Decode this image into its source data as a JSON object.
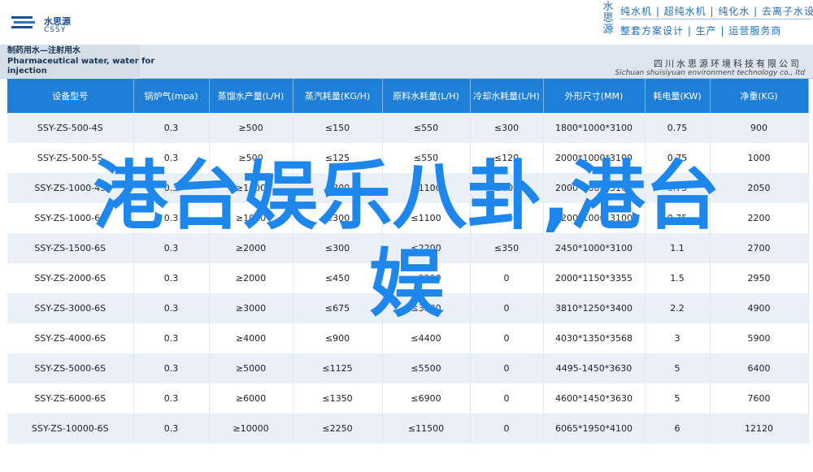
{
  "logo": {
    "cn": "水思源",
    "en": "CSSY"
  },
  "brand": {
    "vertical": "水思源",
    "line1": "纯水机 | 超纯水机 | 纯化水 | 去离子水设备",
    "line2": "整套方案设计 | 生产 | 运营服务商"
  },
  "band": {
    "title_lines": [
      "制药用水—注射用水",
      "Pharmaceutical water, water for",
      "injection"
    ],
    "company_cn": "四川水思源环境科技有限公司",
    "company_en": "Sichuan shuisiyuan environment technology co., ltd"
  },
  "table": {
    "headers": [
      "设备型号",
      "锅炉气(mpa)",
      "蒸馏水产量(L/H)",
      "蒸汽耗量(KG/H)",
      "原料水耗量(L/H)",
      "冷却水耗量(L/H)",
      "外形尺寸(MM)",
      "耗电量(KW)",
      "净重(KG)"
    ],
    "rows": [
      [
        "SSY-ZS-500-4S",
        "0.3",
        "≥500",
        "≤150",
        "≤550",
        "≤300",
        "1800*1000*3100",
        "0.75",
        "900"
      ],
      [
        "SSY-ZS-500-5S",
        "0.3",
        "≥500",
        "≤125",
        "≤550",
        "≤120",
        "2000*1000*3100",
        "0.75",
        "1000"
      ],
      [
        "SSY-ZS-1000-4S",
        "0.3",
        "≥1000",
        "≤300",
        "≤1100",
        "≤600",
        "2000*1000*3100",
        "0.75",
        "2050"
      ],
      [
        "SSY-ZS-1000-6S",
        "0.3",
        "≥1000",
        "≤300",
        "≤1100",
        "≤600",
        "2200*1000*3100",
        "0.75",
        "2200"
      ],
      [
        "SSY-ZS-1500-6S",
        "0.3",
        "≥2000",
        "≤300",
        "≤2200",
        "≤350",
        "2450*1000*3100",
        "1.1",
        "2700"
      ],
      [
        "SSY-ZS-2000-6S",
        "0.3",
        "≥2000",
        "≤450",
        "≤2200",
        "0",
        "2000*1150*3355",
        "1.5",
        "2950"
      ],
      [
        "SSY-ZS-3000-6S",
        "0.3",
        "≥3000",
        "≤675",
        "≤3300",
        "0",
        "3810*1250*3400",
        "2.2",
        "4900"
      ],
      [
        "SSY-ZS-4000-6S",
        "0.3",
        "≥4000",
        "≤900",
        "≤4400",
        "0",
        "4030*1350*3568",
        "3",
        "5900"
      ],
      [
        "SSY-ZS-5000-6S",
        "0.3",
        "≥5000",
        "≤1125",
        "≤5500",
        "0",
        "4495-1450*3630",
        "5",
        "6400"
      ],
      [
        "SSY-ZS-6000-6S",
        "0.3",
        "≥6000",
        "≤1350",
        "≤6900",
        "0",
        "4600*1450*3630",
        "5",
        "7600"
      ],
      [
        "SSY-ZS-10000-6S",
        "0.3",
        "≥10000",
        "≤2250",
        "≤11500",
        "0",
        "6065*1950*4100",
        "6",
        "12120"
      ]
    ]
  },
  "overlay": {
    "line1": "港台娱乐八卦,港台",
    "line2": "娱"
  },
  "colors": {
    "header_blue": "#1e7fd8",
    "overlay_blue": "#1e87ee",
    "row_alt": "#e9f0f8"
  }
}
